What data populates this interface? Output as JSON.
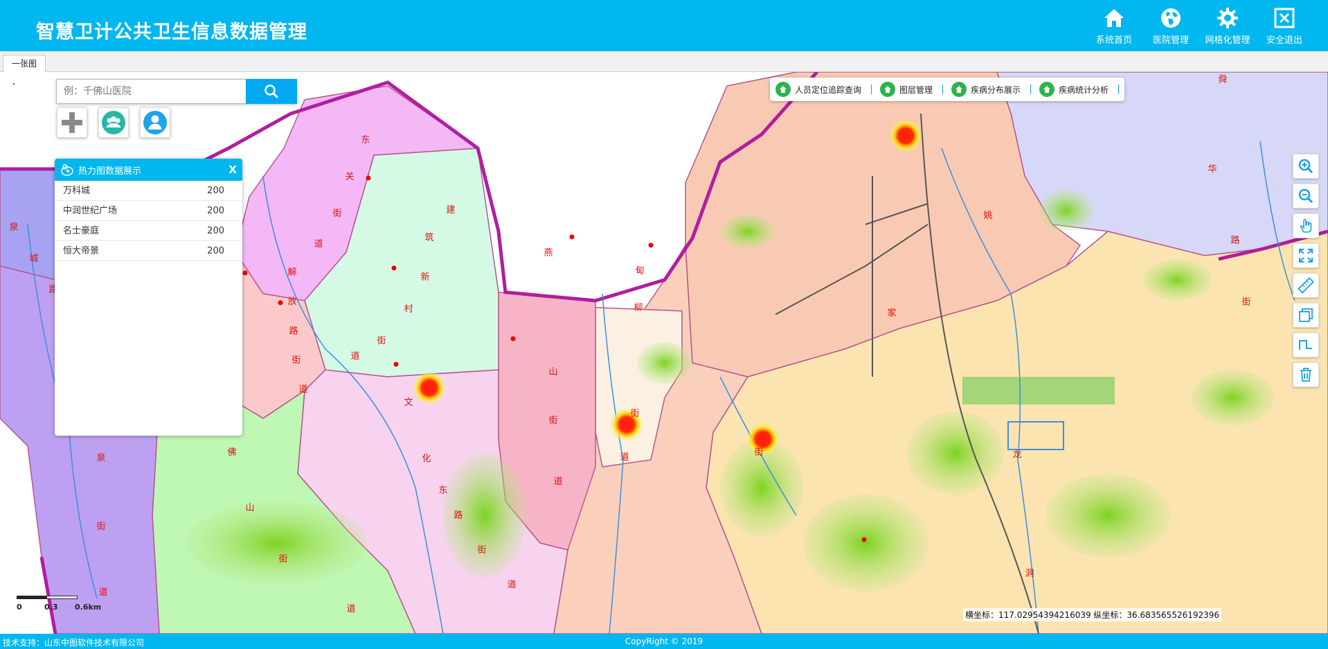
{
  "header": {
    "title": "智慧卫计公共卫生信息数据管理",
    "nav": [
      {
        "label": "系统首页",
        "icon": "home-icon"
      },
      {
        "label": "医院管理",
        "icon": "globe-icon"
      },
      {
        "label": "网格化管理",
        "icon": "gear-icon"
      },
      {
        "label": "安全退出",
        "icon": "close-box-icon"
      }
    ]
  },
  "tabs": [
    {
      "label": "一张图"
    }
  ],
  "search": {
    "placeholder": "例：千佛山医院"
  },
  "panel": {
    "title": "热力图数据展示",
    "close_label": "X",
    "rows": [
      {
        "name": "万科城",
        "value": "200"
      },
      {
        "name": "中润世纪广场",
        "value": "200"
      },
      {
        "name": "名士豪庭",
        "value": "200"
      },
      {
        "name": "恒大帝景",
        "value": "200"
      }
    ]
  },
  "menu": [
    {
      "label": "人员定位追踪查询"
    },
    {
      "label": "图层管理"
    },
    {
      "label": "疾病分布展示"
    },
    {
      "label": "疾病统计分析"
    }
  ],
  "map_labels": {
    "pink_district": [
      "东",
      "关",
      "街",
      "道"
    ],
    "xiefang": [
      "解",
      "放",
      "路",
      "街",
      "道"
    ],
    "jianzhu": [
      "建",
      "筑",
      "新",
      "村",
      "街",
      "道"
    ],
    "wenhua": [
      "文",
      "化",
      "东",
      "路",
      "街",
      "道"
    ],
    "yanshan": [
      "燕",
      "山",
      "街",
      "道"
    ],
    "dianliu": [
      "甸",
      "柳",
      "街",
      "道"
    ],
    "yaojia": [
      "姚",
      "家",
      "街"
    ],
    "qianfo": [
      "佛",
      "山",
      "街",
      "道"
    ],
    "quancheng": [
      "泉",
      "城",
      "路"
    ],
    "quan2": [
      "泉",
      "街",
      "道"
    ],
    "shunhua": [
      "舜",
      "华",
      "路",
      "街"
    ],
    "longdong": [
      "龙",
      "洞"
    ]
  },
  "scale": {
    "t0": "0",
    "t1": "0.3",
    "t2": "0.6km"
  },
  "coords": "横坐标：117.02954394216039 纵坐标：36.683565526192396",
  "footer": {
    "left": "技术支持：山东中图软件技术有限公司",
    "center": "CopyRight © 2019"
  }
}
